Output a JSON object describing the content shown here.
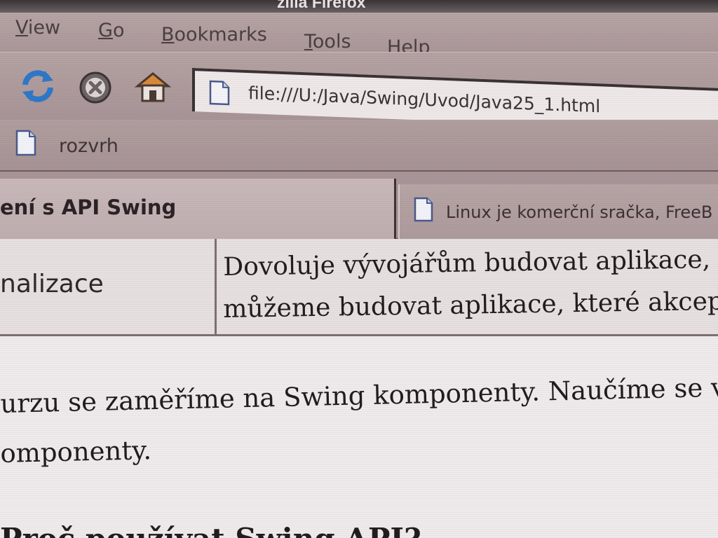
{
  "window": {
    "title_fragment": "zilla Firefox"
  },
  "menubar": {
    "items": [
      {
        "label": "View",
        "accel": "V"
      },
      {
        "label": "Go",
        "accel": "G"
      },
      {
        "label": "Bookmarks",
        "accel": "B"
      },
      {
        "label": "Tools",
        "accel": "T"
      },
      {
        "label": "Help",
        "accel": "H"
      }
    ]
  },
  "navbar": {
    "buttons": [
      {
        "name": "reload",
        "icon": "reload-icon"
      },
      {
        "name": "stop",
        "icon": "stop-icon"
      },
      {
        "name": "home",
        "icon": "home-icon"
      }
    ],
    "url": "file:///U:/Java/Swing/Uvod/Java25_1.html",
    "url_icon": "page-icon"
  },
  "bookmarks": {
    "items": [
      {
        "label": "rozvrh",
        "icon": "page-icon"
      }
    ]
  },
  "tabs": [
    {
      "label": "ení s API Swing",
      "active": true
    },
    {
      "label": "Linux je komerční sračka, FreeB",
      "active": false,
      "icon": "page-icon"
    }
  ],
  "content": {
    "table": {
      "left_cell": "nalizace",
      "right_cell_lines": [
        "Dovoluje vývojářům budovat aplikace, kte",
        "můžeme budovat aplikace, které akceptují"
      ]
    },
    "paragraph_lines": [
      "urzu se zaměříme na Swing komponenty. Naučíme se volit",
      "omponenty."
    ],
    "heading": "Proč používat Swing API?"
  },
  "colors": {
    "chrome": "#a99597",
    "content_bg": "#efeaeb",
    "text": "#221c1e",
    "reload_blue": "#2f78c8"
  }
}
